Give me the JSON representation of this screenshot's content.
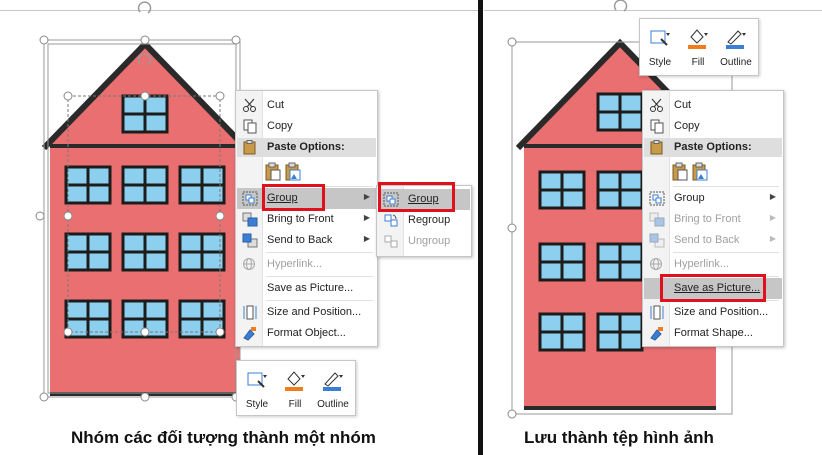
{
  "left": {
    "context_menu": {
      "cut": "Cut",
      "copy": "Copy",
      "paste_options": "Paste Options:",
      "group": "Group",
      "bring_to_front": "Bring to Front",
      "send_to_back": "Send to Back",
      "hyperlink": "Hyperlink...",
      "save_as_picture": "Save as Picture...",
      "size_and_position": "Size and Position...",
      "format_object": "Format Object..."
    },
    "submenu": {
      "group": "Group",
      "regroup": "Regroup",
      "ungroup": "Ungroup"
    },
    "mini_toolbar": {
      "style": "Style",
      "fill": "Fill",
      "outline": "Outline"
    },
    "caption": "Nhóm các đối tượng thành một nhóm"
  },
  "right": {
    "mini_toolbar": {
      "style": "Style",
      "fill": "Fill",
      "outline": "Outline"
    },
    "context_menu": {
      "cut": "Cut",
      "copy": "Copy",
      "paste_options": "Paste Options:",
      "group": "Group",
      "bring_to_front": "Bring to Front",
      "send_to_back": "Send to Back",
      "hyperlink": "Hyperlink...",
      "save_as_picture": "Save as Picture...",
      "size_and_position": "Size and Position...",
      "format_shape": "Format Shape..."
    },
    "caption": "Lưu thành tệp hình ảnh"
  },
  "colors": {
    "house_wall": "#e96f70",
    "house_roof": "#2a2a2a",
    "window_glass": "#8dcfee",
    "window_frame": "#1c1c1c",
    "highlight": "#e0101c",
    "fill_orange": "#f07c1e",
    "outline_blue": "#3b7fd4"
  }
}
